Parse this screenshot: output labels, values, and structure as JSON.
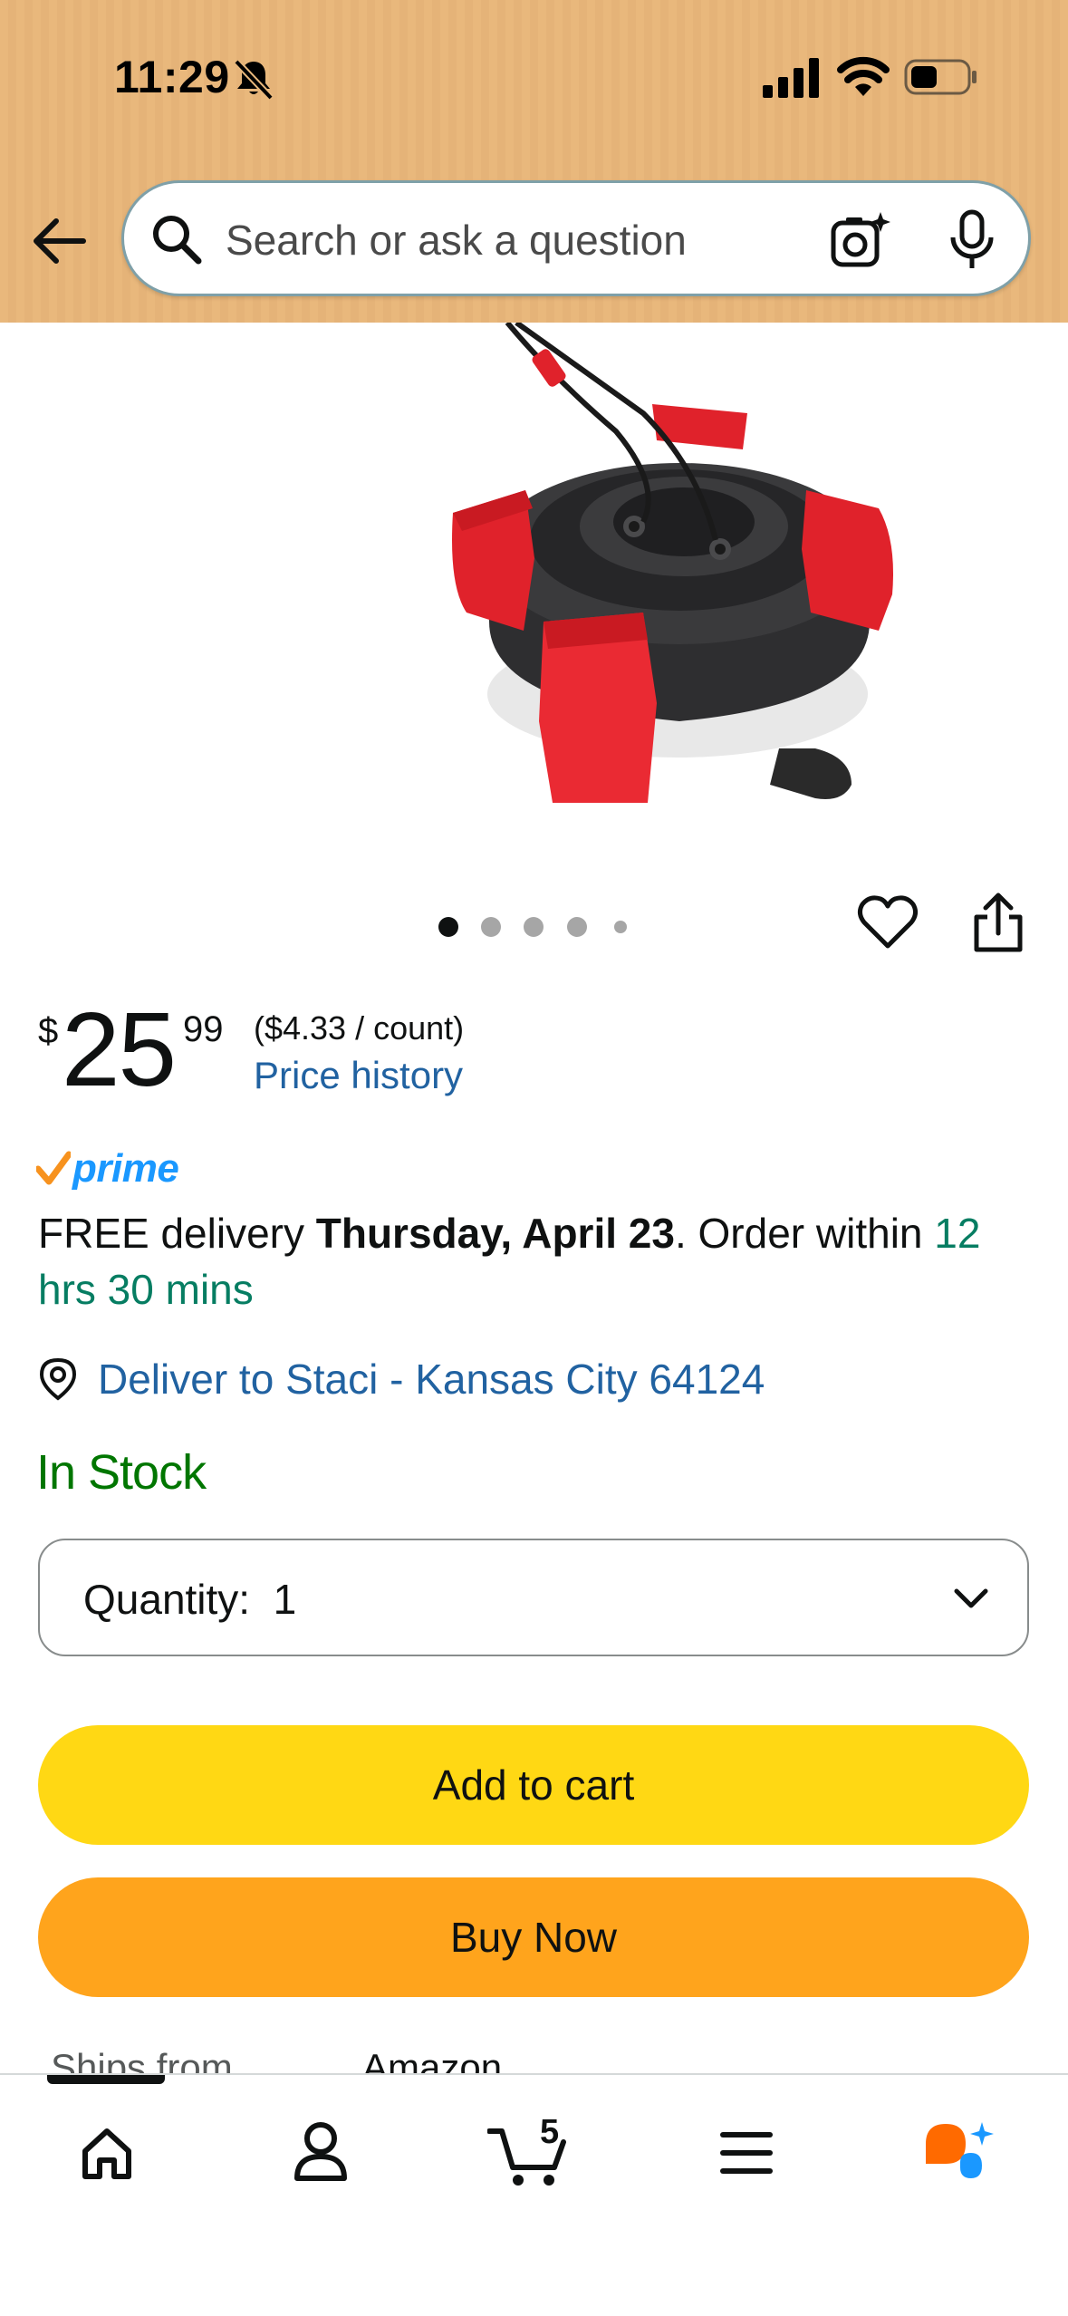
{
  "status_bar": {
    "time": "11:29"
  },
  "search": {
    "placeholder": "Search or ask a question"
  },
  "product": {
    "image_alt": "Red and black round mount product",
    "carousel_dots": 5,
    "carousel_active": 0
  },
  "price": {
    "symbol": "$",
    "whole": "25",
    "fraction": "99",
    "unit_price": "($4.33 / count)",
    "history_link": "Price history"
  },
  "prime": {
    "label": "prime"
  },
  "delivery": {
    "prefix": "FREE delivery ",
    "date": "Thursday, April 23",
    "middle": ". Order within ",
    "countdown": "12 hrs 30 mins"
  },
  "deliver_to": {
    "text": "Deliver to Staci - Kansas City 64124"
  },
  "stock": {
    "status": "In Stock"
  },
  "quantity": {
    "label": "Quantity:",
    "value": "1"
  },
  "buttons": {
    "add_to_cart": "Add to cart",
    "buy_now": "Buy Now"
  },
  "ships": {
    "label": "Ships from",
    "value": "Amazon"
  },
  "bottom_nav": {
    "cart_count": "5",
    "items": [
      "home-icon",
      "account-icon",
      "cart-icon",
      "menu-icon",
      "rufus-assistant-icon"
    ]
  },
  "colors": {
    "header_bg": "#e9b87c",
    "add_to_cart": "#ffd814",
    "buy_now": "#ffa41c",
    "link": "#2162a1",
    "in_stock": "#007600",
    "countdown": "#067d62",
    "prime": "#1a98ff"
  }
}
